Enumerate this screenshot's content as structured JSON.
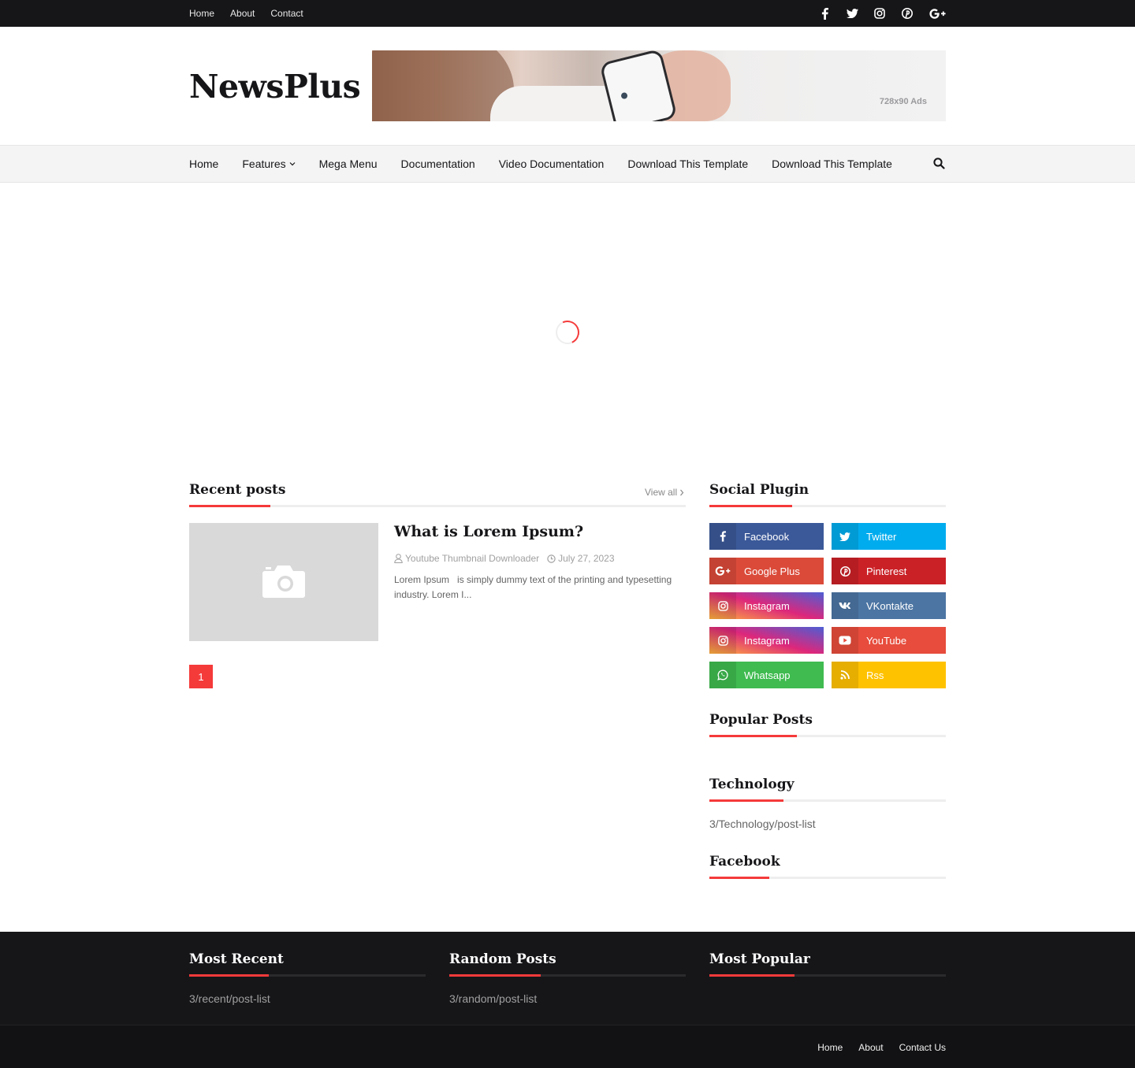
{
  "topbar": {
    "links": [
      "Home",
      "About",
      "Contact"
    ],
    "social_icons": [
      "facebook-icon",
      "twitter-icon",
      "instagram-icon",
      "pinterest-icon",
      "google-plus-icon"
    ]
  },
  "header": {
    "logo": "NewsPlus",
    "ad_label": "728x90 Ads"
  },
  "nav": {
    "items": [
      "Home",
      "Features",
      "Mega Menu",
      "Documentation",
      "Video Documentation",
      "Download This Template",
      "Download This Template"
    ]
  },
  "recent": {
    "title": "Recent posts",
    "view_all": "View all",
    "post": {
      "title": "What is Lorem Ipsum?",
      "author": "Youtube Thumbnail Downloader",
      "date": "July 27, 2023",
      "snippet": "Lorem Ipsum   is simply dummy text of the printing and typesetting industry. Lorem I..."
    },
    "page": "1"
  },
  "sidebar": {
    "social_title": "Social Plugin",
    "social": [
      {
        "label": "Facebook",
        "color": "#3b5999"
      },
      {
        "label": "Twitter",
        "color": "#00acee"
      },
      {
        "label": "Google Plus",
        "color": "#db4a39"
      },
      {
        "label": "Pinterest",
        "color": "#ca2127"
      },
      {
        "label": "Instagram",
        "color": "#dd2a7b"
      },
      {
        "label": "VKontakte",
        "color": "#4c75a3"
      },
      {
        "label": "Instagram",
        "color": "#dd2a7b"
      },
      {
        "label": "YouTube",
        "color": "#e74c3c"
      },
      {
        "label": "Whatsapp",
        "color": "#3fbb50"
      },
      {
        "label": "Rss",
        "color": "#ffc200"
      }
    ],
    "popular_title": "Popular Posts",
    "technology_title": "Technology",
    "technology_text": "3/Technology/post-list",
    "facebook_title": "Facebook"
  },
  "footer": {
    "most_recent_title": "Most Recent",
    "most_recent_text": "3/recent/post-list",
    "random_title": "Random Posts",
    "random_text": "3/random/post-list",
    "popular_title": "Most Popular",
    "links": [
      "Home",
      "About",
      "Contact Us"
    ]
  },
  "colors": {
    "accent": "#f53a3a",
    "dark": "#161619"
  }
}
